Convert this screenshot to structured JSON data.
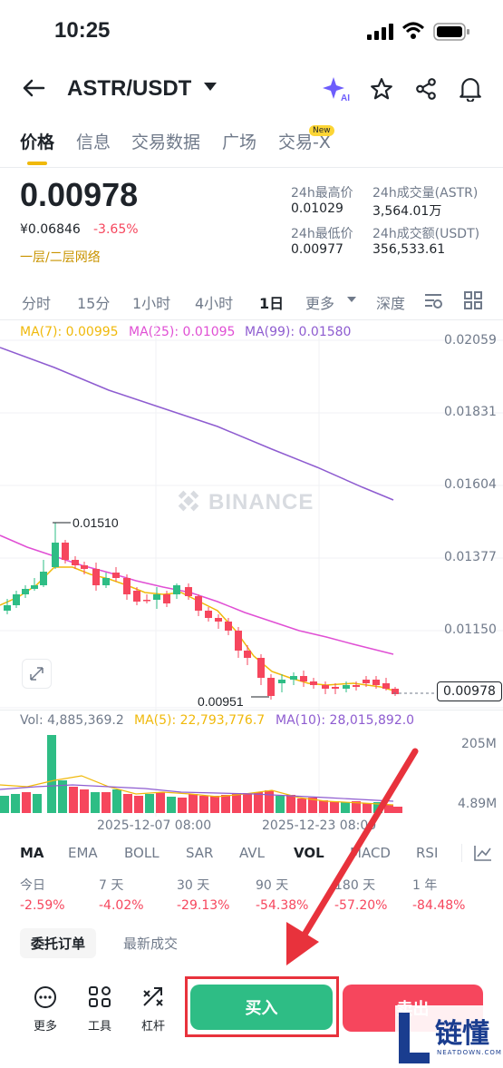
{
  "status": {
    "time": "10:25"
  },
  "header": {
    "pair": "ASTR/USDT"
  },
  "tabs": [
    "价格",
    "信息",
    "交易数据",
    "广场",
    "交易-X"
  ],
  "tab_badge": "New",
  "price": {
    "last": "0.00978",
    "cny": "¥0.06846",
    "change": "-3.65%",
    "network": "一层/二层网络",
    "high_label": "24h最高价",
    "high": "0.01029",
    "low_label": "24h最低价",
    "low": "0.00977",
    "vol_label": "24h成交量(ASTR)",
    "vol": "3,564.01万",
    "amount_label": "24h成交额(USDT)",
    "amount": "356,533.61"
  },
  "timeframes": [
    "分时",
    "15分",
    "1小时",
    "4小时",
    "1日",
    "更多",
    "深度"
  ],
  "ma": {
    "ma7": "MA(7): 0.00995",
    "ma25": "MA(25): 0.01095",
    "ma99": "MA(99): 0.01580"
  },
  "yaxis": [
    "0.02059",
    "0.01831",
    "0.01604",
    "0.01377",
    "0.01150"
  ],
  "annot": {
    "high": "0.01510",
    "low": "0.00951",
    "current": "0.00978",
    "watermark": "BINANCE"
  },
  "volume": {
    "vol": "Vol: 4,885,369.2",
    "ma5": "MA(5): 22,793,776.7",
    "ma10": "MA(10): 28,015,892.0",
    "ymax": "205M",
    "ymin": "4.89M"
  },
  "dates": [
    "2025-12-07 08:00",
    "2025-12-23 08:00"
  ],
  "indicators": [
    "MA",
    "EMA",
    "BOLL",
    "SAR",
    "AVL",
    "VOL",
    "MACD",
    "RSI"
  ],
  "changes": [
    {
      "label": "今日",
      "value": "-2.59%"
    },
    {
      "label": "7 天",
      "value": "-4.02%"
    },
    {
      "label": "30 天",
      "value": "-29.13%"
    },
    {
      "label": "90 天",
      "value": "-54.38%"
    },
    {
      "label": "180 天",
      "value": "-57.20%"
    },
    {
      "label": "1 年",
      "value": "-84.48%"
    }
  ],
  "order_tabs": [
    "委托订单",
    "最新成交"
  ],
  "tools": [
    "更多",
    "工具",
    "杠杆"
  ],
  "buttons": {
    "buy": "买入",
    "sell": "卖出"
  },
  "logo": {
    "text": "链懂",
    "sub": "NEATDOWN.COM"
  },
  "colors": {
    "up": "#2ebd85",
    "down": "#f6465d",
    "accent": "#f0b90b",
    "ma7": "#f0b90b",
    "ma25": "#e04fd4",
    "ma99": "#8e5cd0",
    "arrow": "#e8323c"
  }
}
